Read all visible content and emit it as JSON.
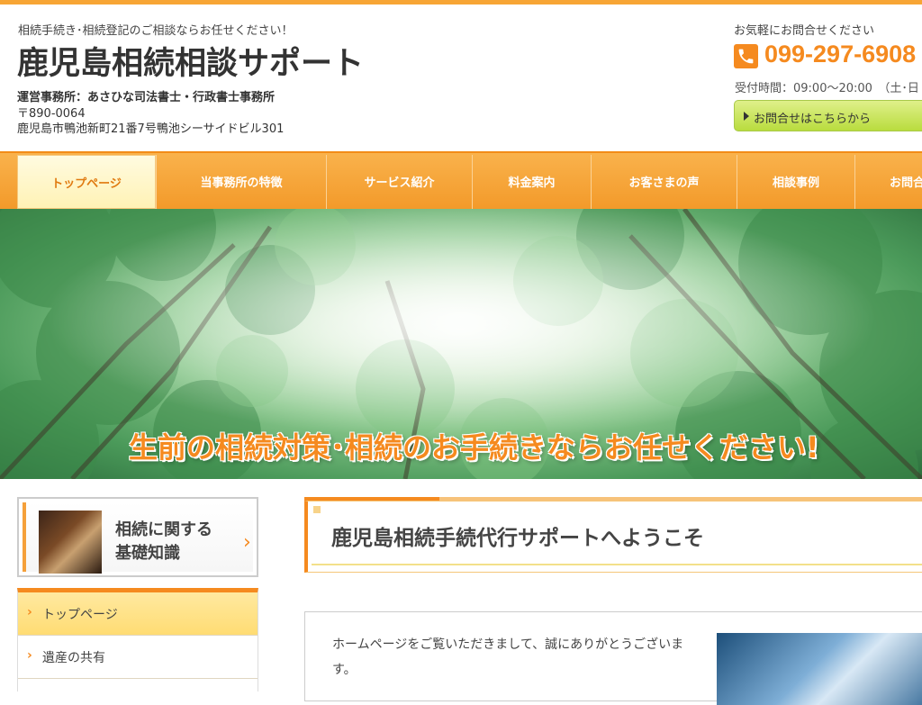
{
  "header": {
    "tagline": "相続手続き･相続登記のご相談ならお任せください！",
    "site_title": "鹿児島相続相談サポート",
    "office": "運営事務所：あさひな司法書士・行政書士事務所",
    "postal": "〒890-0064",
    "address": "鹿児島市鴨池新町21番7号鴨池シーサイドビル301",
    "contact_lead": "お気軽にお問合せください",
    "phone": "099-297-6908",
    "hours": "受付時間：09:00～20:00　（土･日",
    "contact_button": "お問合せはこちらから"
  },
  "nav": {
    "items": [
      {
        "label": "トップページ"
      },
      {
        "label": "当事務所の特徴"
      },
      {
        "label": "サービス紹介"
      },
      {
        "label": "料金案内"
      },
      {
        "label": "お客さまの声"
      },
      {
        "label": "相談事例"
      },
      {
        "label": "お問合"
      }
    ]
  },
  "hero": {
    "headline": "生前の相続対策･相続のお手続きならお任せください!"
  },
  "sidebar": {
    "basics_line1": "相続に関する",
    "basics_line2": "基礎知識",
    "items": [
      {
        "label": "トップページ"
      },
      {
        "label": "遺産の共有"
      }
    ]
  },
  "main": {
    "welcome_title": "鹿児島相続手続代行サポートへようこそ",
    "intro": "ホームページをご覧いただきまして、誠にありがとうございます。"
  },
  "colors": {
    "accent": "#f58a1f",
    "nav_bg": "#f7a535",
    "button_green": "#c6e45a"
  }
}
